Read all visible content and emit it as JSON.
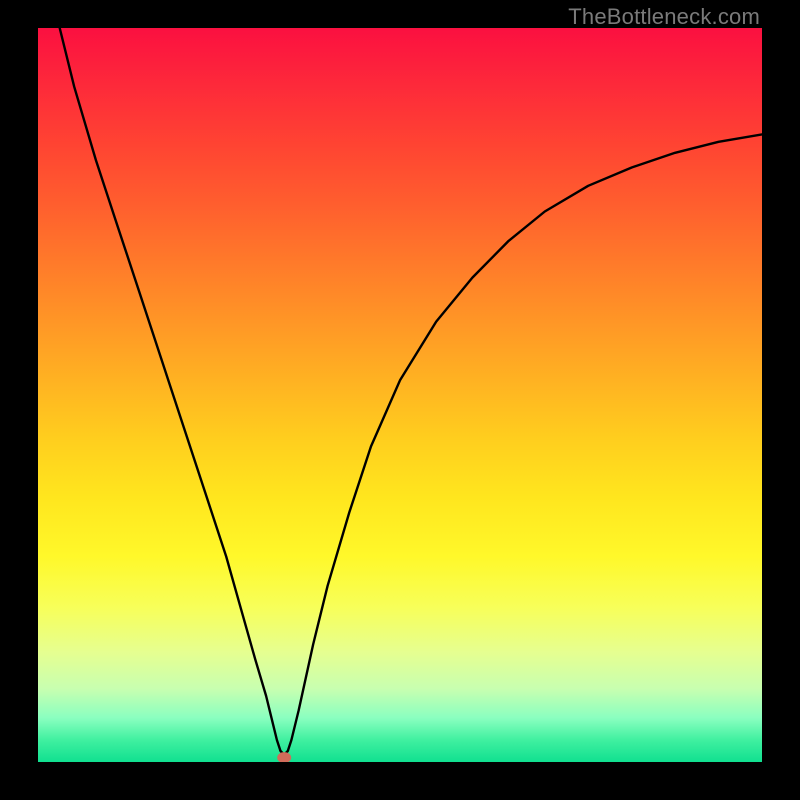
{
  "watermark": {
    "text": "TheBottleneck.com"
  },
  "colors": {
    "black": "#000000",
    "curve": "#000000",
    "marker_fill": "#d06c5a",
    "marker_stroke": "#7a3b30"
  },
  "chart_data": {
    "type": "line",
    "title": "",
    "xlabel": "",
    "ylabel": "",
    "xlim": [
      0,
      100
    ],
    "ylim": [
      0,
      100
    ],
    "grid": false,
    "legend": false,
    "series": [
      {
        "name": "curve",
        "x": [
          3,
          5,
          8,
          11,
          14,
          17,
          20,
          23,
          26,
          28,
          30,
          31.5,
          32.5,
          33,
          33.5,
          34,
          34.5,
          35,
          36,
          38,
          40,
          43,
          46,
          50,
          55,
          60,
          65,
          70,
          76,
          82,
          88,
          94,
          100
        ],
        "y": [
          100,
          92,
          82,
          73,
          64,
          55,
          46,
          37,
          28,
          21,
          14,
          9,
          5,
          3,
          1.5,
          1,
          1.5,
          3,
          7,
          16,
          24,
          34,
          43,
          52,
          60,
          66,
          71,
          75,
          78.5,
          81,
          83,
          84.5,
          85.5
        ]
      }
    ],
    "markers": [
      {
        "name": "vertex-dot",
        "x": 34,
        "y": 0.6
      }
    ],
    "comment": "Values estimated from gridless plot; x and y as percent of plot area (0..100)."
  }
}
